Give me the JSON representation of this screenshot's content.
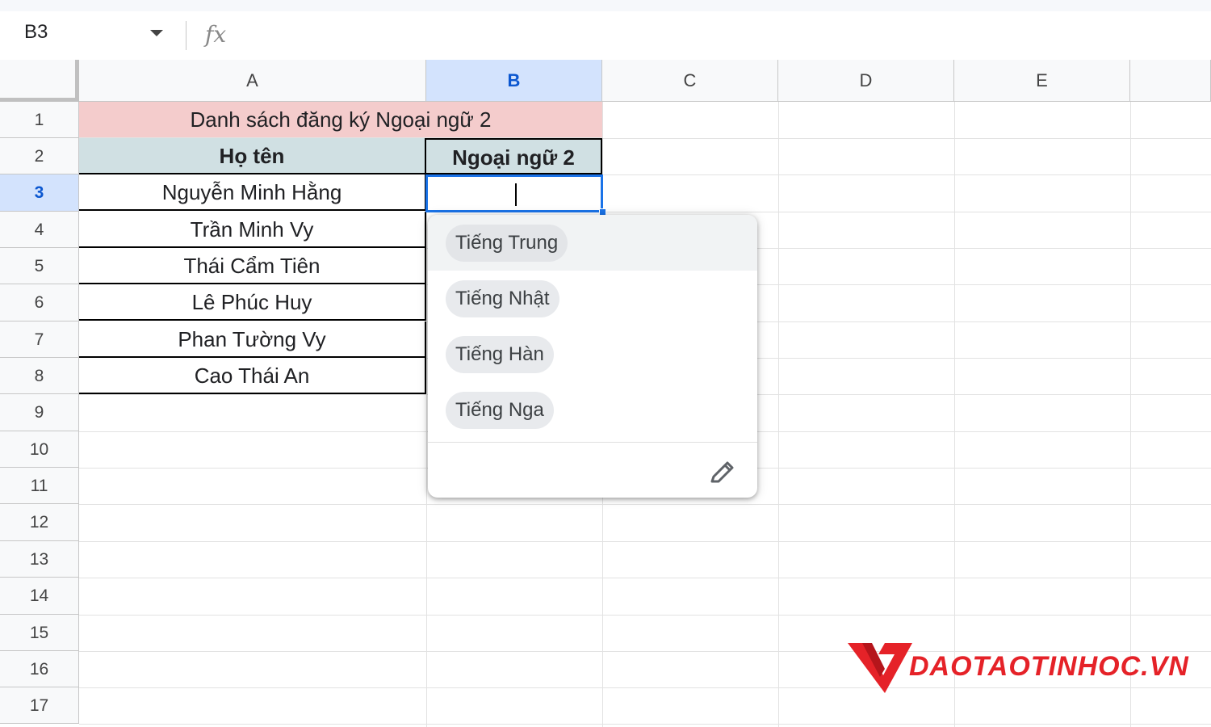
{
  "formula_bar": {
    "name_box": "B3",
    "fx_label": "fx"
  },
  "columns": [
    "A",
    "B",
    "C",
    "D",
    "E"
  ],
  "rows": [
    "1",
    "2",
    "3",
    "4",
    "5",
    "6",
    "7",
    "8",
    "9",
    "10",
    "11",
    "12",
    "13",
    "14",
    "15",
    "16",
    "17"
  ],
  "sheet": {
    "title": "Danh sách đăng ký Ngoại ngữ 2",
    "header_name": "Họ tên",
    "header_lang": "Ngoại ngữ 2",
    "names": [
      "Nguyễn Minh Hằng",
      "Trần Minh Vy",
      "Thái Cẩm Tiên",
      "Lê Phúc Huy",
      "Phan Tường Vy",
      "Cao Thái An"
    ]
  },
  "dropdown": {
    "options": [
      "Tiếng Trung",
      "Tiếng Nhật",
      "Tiếng Hàn",
      "Tiếng Nga"
    ],
    "edit_icon": "pencil-icon"
  },
  "watermark": {
    "text": "DAOTAOTINHOC.VN",
    "color": "#e52228"
  }
}
